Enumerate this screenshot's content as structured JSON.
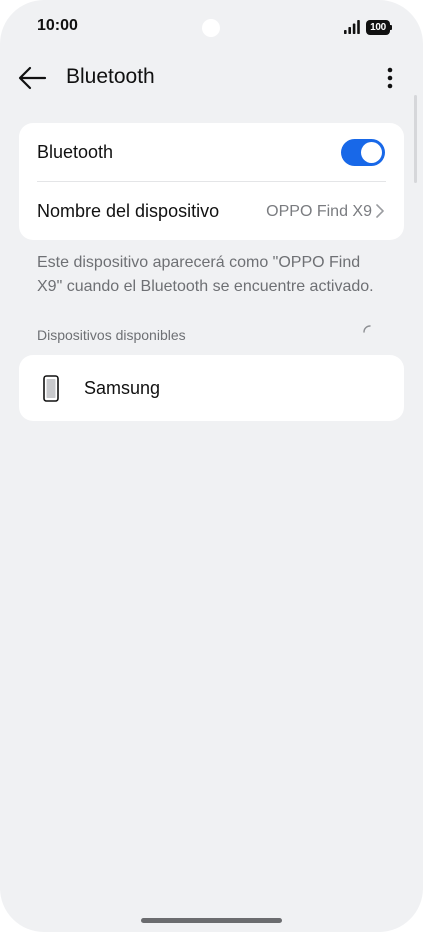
{
  "status_bar": {
    "time": "10:00",
    "battery": "100"
  },
  "header": {
    "title": "Bluetooth",
    "back_icon": "arrow-left-icon",
    "more_icon": "more-vertical-icon"
  },
  "bluetooth_card": {
    "toggle_label": "Bluetooth",
    "toggle_on": true,
    "device_name_label": "Nombre del dispositivo",
    "device_name_value": "OPPO Find X9"
  },
  "hint_text": "Este dispositivo aparecerá como \"OPPO Find X9\" cuando el Bluetooth se encuentre activado.",
  "available_section": {
    "label": "Dispositivos disponibles",
    "devices": [
      {
        "name": "Samsung",
        "icon": "smartphone-icon"
      }
    ]
  },
  "colors": {
    "accent": "#1868e8",
    "background": "#f0f1f3",
    "card": "#ffffff"
  }
}
